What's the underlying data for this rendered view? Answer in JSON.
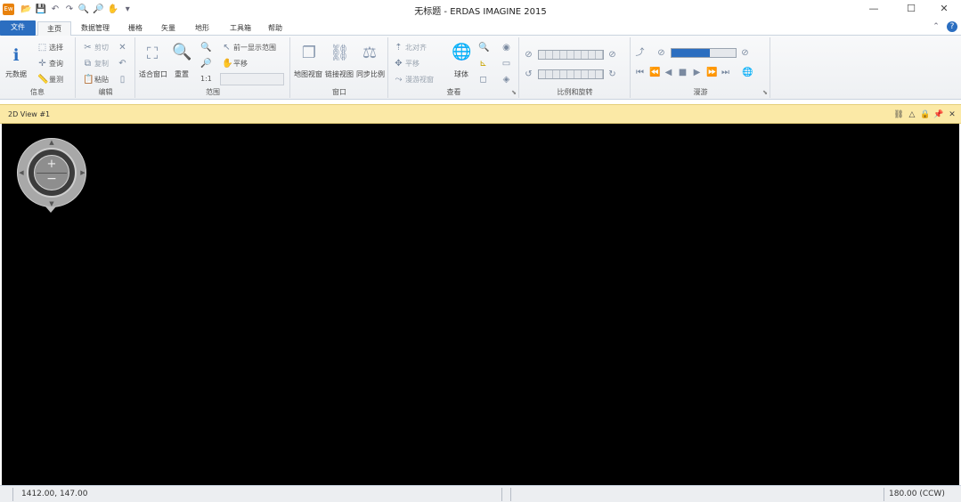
{
  "window": {
    "title": "无标题 - ERDAS IMAGINE 2015",
    "app_logo_text": "Ew",
    "minimize": "—",
    "maximize": "☐",
    "close": "✕"
  },
  "quick_access": {
    "icons": [
      "open-folder-icon",
      "save-icon",
      "undo-icon",
      "redo-icon",
      "zoom-in-icon",
      "zoom-out-icon",
      "pan-icon",
      "customize-icon"
    ],
    "glyphs": [
      "📂",
      "💾",
      "↶",
      "↷",
      "🔍",
      "🔎",
      "✋",
      "▾"
    ]
  },
  "ribbon_tabs": [
    "文件",
    "主页",
    "数据管理",
    "栅格",
    "矢量",
    "地形",
    "工具箱",
    "帮助"
  ],
  "ribbon_tabs_active": "主页",
  "help": {
    "up": "⌃",
    "question": "?"
  },
  "groups": {
    "info": {
      "label": "信息",
      "big_button": "元数据",
      "items": [
        "选择",
        "查询",
        "量测"
      ]
    },
    "edit": {
      "label": "编辑",
      "items": [
        "剪切",
        "复制",
        "粘贴"
      ]
    },
    "extent": {
      "label": "范围",
      "fit_to_frame": "适合窗口",
      "resample": "重置",
      "items": [
        "前一显示范围",
        "平移"
      ],
      "scale_label": "1:1"
    },
    "window": {
      "label": "窗口",
      "items": [
        "地图视窗",
        "链接视图",
        "同步比例"
      ]
    },
    "view": {
      "label": "查看",
      "items": [
        "北对齐",
        "平移",
        "漫游视窗"
      ],
      "globe": "球体"
    },
    "rotate": {
      "label": "比例和旋转"
    },
    "roam": {
      "label": "漫游"
    }
  },
  "view": {
    "title": "2D View #1",
    "controls": [
      "link-icon",
      "warning-icon",
      "lock-icon",
      "pin-icon",
      "close-icon"
    ],
    "control_glyphs": [
      "⛓",
      "△",
      "🔒",
      "📌",
      "✕"
    ]
  },
  "statusbar": {
    "coordinates": "1412.00, 147.00",
    "rotation": "180.00 (CCW)"
  }
}
